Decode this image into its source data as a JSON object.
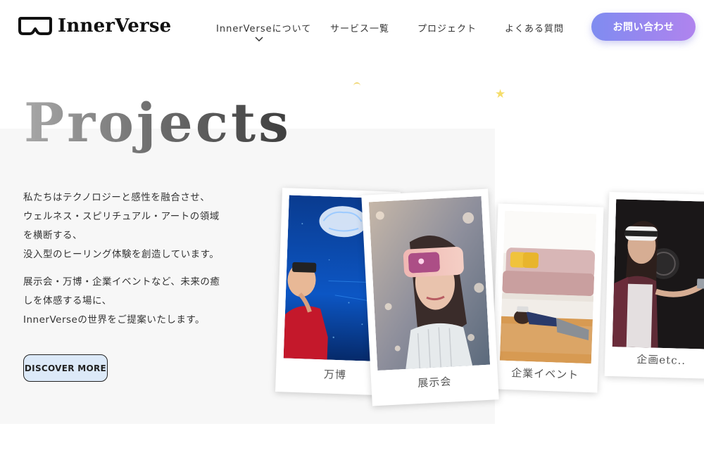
{
  "brand": {
    "name": "InnerVerse",
    "logo_icon": "vr-goggles-icon"
  },
  "nav": {
    "items": [
      {
        "label": "InnerVerseについて"
      },
      {
        "label": "サービス一覧"
      },
      {
        "label": "プロジェクト"
      },
      {
        "label": "よくある質問"
      }
    ],
    "contact_label": "お問い合わせ"
  },
  "hero": {
    "title": "Projects",
    "paragraph1": [
      "私たちはテクノロジーと感性を融合させ、",
      "ウェルネス・スピリチュアル・アートの領域",
      "を横断する、",
      "没入型のヒーリング体験を創造しています。"
    ],
    "paragraph2": [
      "展示会・万博・企業イベントなど、未来の癒",
      "しを体感する場に、",
      "InnerVerseの世界をご提案いたします。"
    ],
    "cta_label": "DISCOVER MORE"
  },
  "cards": [
    {
      "caption": "万博"
    },
    {
      "caption": "展示会"
    },
    {
      "caption": "企業イベント"
    },
    {
      "caption": "企画etc.."
    }
  ],
  "colors": {
    "accent_start": "#7f8cf0",
    "accent_end": "#b084ee",
    "cta_bg": "#dce9f8",
    "panel_bg": "#f7f7f7"
  }
}
